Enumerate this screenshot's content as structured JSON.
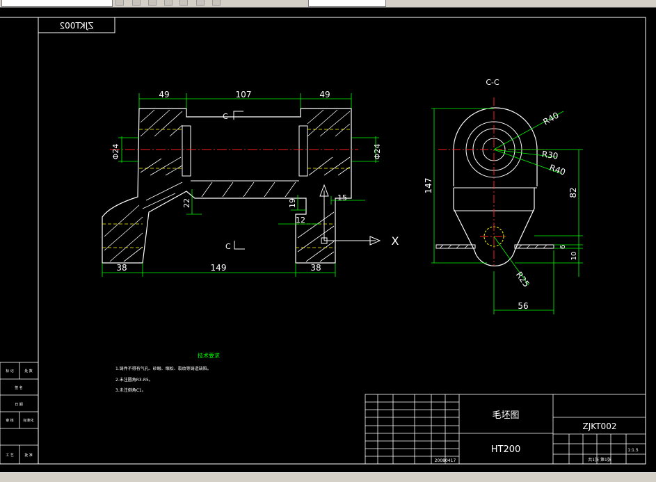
{
  "colors": {
    "background": "#000000",
    "outline": "#ffffff",
    "dimension": "#00ff00",
    "center": "#ff2020",
    "hatch": "#ffffff",
    "hidden": "#ffff00",
    "annotation": "#00ff00"
  },
  "toolbar": {
    "icons": [
      "cursor-icon",
      "undo-icon",
      "zoom-icon",
      "pan-icon",
      "layer-icon",
      "properties-icon",
      "help-icon"
    ]
  },
  "drawing": {
    "mirrored_code": "ZJKT002",
    "front_view": {
      "dims": {
        "top_left": "49",
        "top_mid": "107",
        "top_right": "49",
        "dia_left": "Φ24",
        "dia_right": "Φ24",
        "d22": "22",
        "d19": "19",
        "d15": "15",
        "d12": "12",
        "bot_left": "38",
        "bot_mid": "149",
        "bot_right": "38"
      },
      "section_mark_top": "C",
      "section_mark_bottom": "C",
      "axis_label": "X"
    },
    "section_view": {
      "title": "C-C",
      "dims": {
        "r40a": "R40",
        "r30": "R30",
        "r40b": "R40",
        "r25": "R25",
        "h147": "147",
        "h82": "82",
        "h6": "6",
        "h10": "10",
        "w56": "56"
      }
    },
    "notes": {
      "title": "技术要求",
      "items": [
        "1.铸件不得有气孔、砂眼、缩松、裂纹等铸造缺陷。",
        "2.未注圆角R3-R5。",
        "3.未注倒角C1。"
      ]
    },
    "title_block": {
      "drawing_name": "毛坯图",
      "material": "HT200",
      "code": "ZJKT002",
      "date": "20080417",
      "scale": "1:1.5",
      "sheet": "共1张 第1张"
    },
    "side_table": {
      "rows": [
        "标 记",
        "处 数",
        "签 名",
        "日 期",
        "审 核",
        "标准化",
        "工 艺",
        "批 准"
      ]
    }
  }
}
